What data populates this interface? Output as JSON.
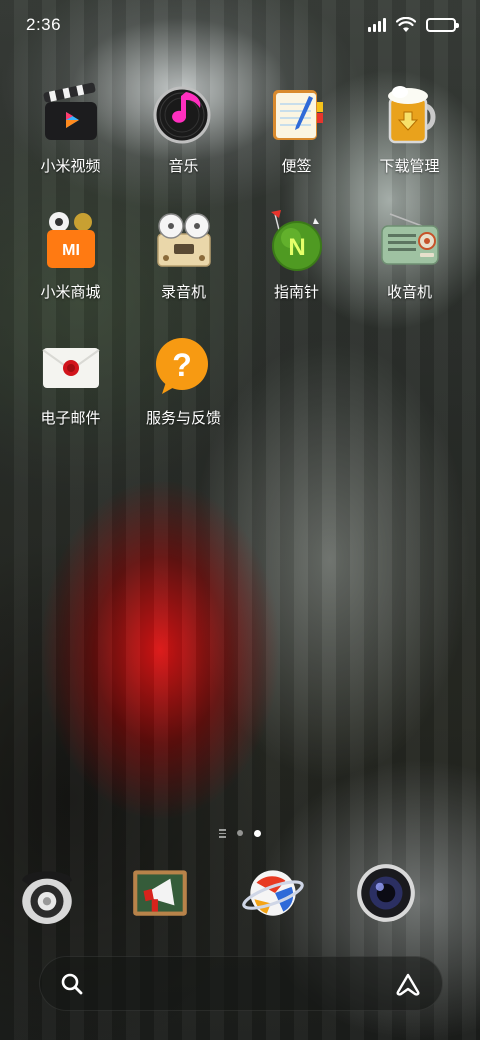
{
  "status_bar": {
    "time": "2:36",
    "battery_level": 1.0,
    "signal_bars": 4
  },
  "apps": [
    {
      "label": "小米视频",
      "icon": "video-clapper-icon"
    },
    {
      "label": "音乐",
      "icon": "music-disc-icon"
    },
    {
      "label": "便签",
      "icon": "notepad-icon"
    },
    {
      "label": "下载管理",
      "icon": "beer-mug-icon"
    },
    {
      "label": "小米商城",
      "icon": "mi-shopping-bag-icon"
    },
    {
      "label": "录音机",
      "icon": "reel-recorder-icon"
    },
    {
      "label": "指南针",
      "icon": "compass-grass-icon"
    },
    {
      "label": "收音机",
      "icon": "radio-icon"
    },
    {
      "label": "电子邮件",
      "icon": "envelope-icon"
    },
    {
      "label": "服务与反馈",
      "icon": "question-bubble-icon"
    }
  ],
  "page_indicator": {
    "pages": 2,
    "active_page": 2
  },
  "dock": [
    {
      "icon": "rotary-phone-icon"
    },
    {
      "icon": "chalkboard-megaphone-icon"
    },
    {
      "icon": "soccer-ball-planet-icon"
    },
    {
      "icon": "camera-lens-icon"
    }
  ],
  "search": {
    "placeholder": "",
    "search_icon": "search-icon",
    "assistant_icon": "assistant-a-icon"
  },
  "colors": {
    "wallpaper_red": "#e01414",
    "label_text": "#ffffff"
  }
}
